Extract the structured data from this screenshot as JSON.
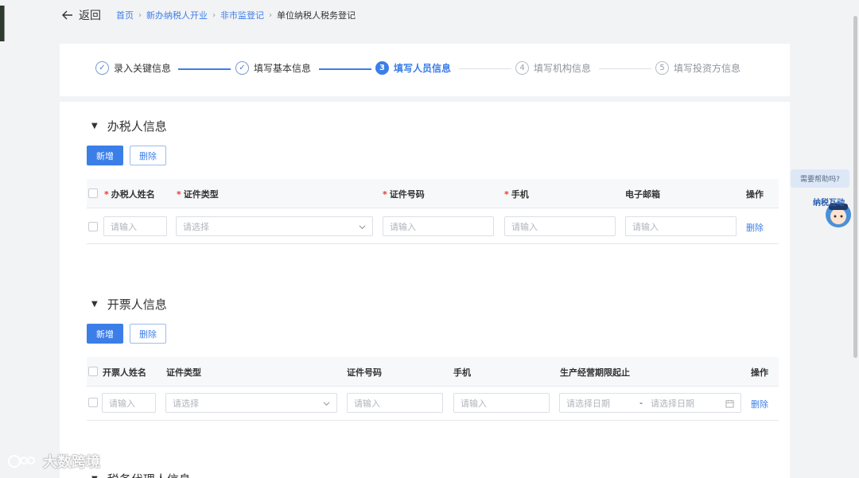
{
  "header": {
    "back_label": "返回",
    "breadcrumb": [
      "首页",
      "新办纳税人开业",
      "非市监登记",
      "单位纳税人税务登记"
    ]
  },
  "steps": [
    {
      "num": "✓",
      "label": "录入关键信息",
      "state": "done"
    },
    {
      "num": "✓",
      "label": "填写基本信息",
      "state": "done"
    },
    {
      "num": "3",
      "label": "填写人员信息",
      "state": "active"
    },
    {
      "num": "4",
      "label": "填写机构信息",
      "state": "todo"
    },
    {
      "num": "5",
      "label": "填写投资方信息",
      "state": "todo"
    }
  ],
  "tax_handler": {
    "title": "办税人信息",
    "add_label": "新增",
    "delete_label": "删除",
    "columns": [
      "办税人姓名",
      "证件类型",
      "证件号码",
      "手机",
      "电子邮箱",
      "操作"
    ],
    "row": {
      "name_placeholder": "请输入",
      "idtype_placeholder": "请选择",
      "idno_placeholder": "请输入",
      "phone_placeholder": "请输入",
      "email_placeholder": "请输入",
      "action": "删除"
    }
  },
  "invoicer": {
    "title": "开票人信息",
    "add_label": "新增",
    "delete_label": "删除",
    "columns": [
      "开票人姓名",
      "证件类型",
      "证件号码",
      "手机",
      "生产经营期限起止",
      "操作"
    ],
    "row": {
      "name_placeholder": "请输入",
      "idtype_placeholder": "请选择",
      "idno_placeholder": "请输入",
      "phone_placeholder": "请输入",
      "start_placeholder": "请选择日期",
      "range_sep": "-",
      "end_placeholder": "请选择日期",
      "action": "删除"
    }
  },
  "next_section_title": "税务代理人信息",
  "help": {
    "bubble": "需要帮助吗?",
    "robot_text": "纳税互动"
  },
  "watermark": "大数跨境",
  "colors": {
    "accent": "#3c7ee8",
    "required": "#e53935"
  }
}
